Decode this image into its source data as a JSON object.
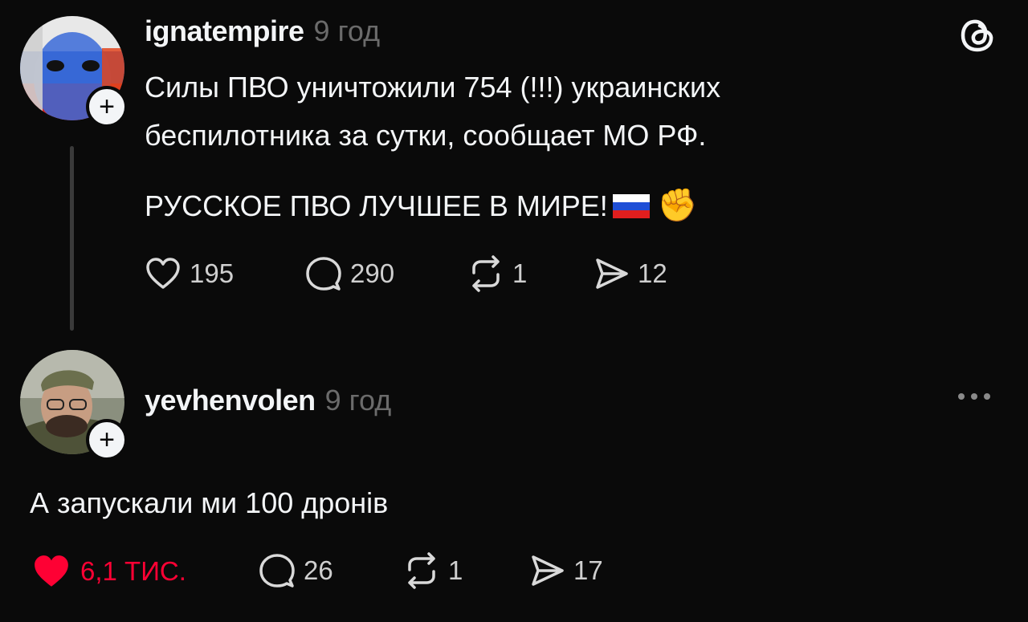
{
  "colors": {
    "background": "#0a0a0a",
    "text": "#f3f5f7",
    "muted": "#6b6b6b",
    "like_active": "#fe0134"
  },
  "post": {
    "username": "ignatempire",
    "time": "9 год",
    "text_line1": "Силы ПВО уничтожили 754 (!!!) украинских",
    "text_line2": "беспилотника за сутки, сообщает МО РФ.",
    "text_line3": "РУССКОЕ ПВО ЛУЧШЕЕ В МИРЕ!",
    "emoji_fist": "✊",
    "actions": {
      "likes": "195",
      "replies": "290",
      "reposts": "1",
      "shares": "12"
    },
    "icons": [
      "threads-logo-icon",
      "heart-icon",
      "comment-icon",
      "repost-icon",
      "share-icon",
      "russia-flag-icon"
    ]
  },
  "reply": {
    "username": "yevhenvolen",
    "time": "9 год",
    "text": "А запускали ми 100 дронів",
    "actions": {
      "likes": "6,1 тис.",
      "replies": "26",
      "reposts": "1",
      "shares": "17"
    },
    "icons": [
      "more-options-icon",
      "heart-filled-icon",
      "comment-icon",
      "repost-icon",
      "share-icon"
    ]
  }
}
